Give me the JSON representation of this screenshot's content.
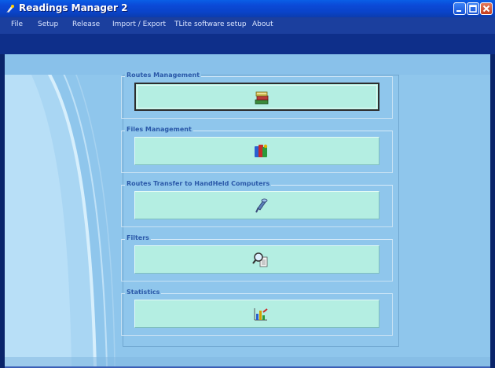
{
  "window": {
    "title": "Readings Manager 2"
  },
  "menu": {
    "items": [
      "File",
      "Setup",
      "Release",
      "Import / Export",
      "TLite software setup",
      "About"
    ]
  },
  "groups": [
    {
      "label": "Routes Management",
      "icon": "books-icon"
    },
    {
      "label": "Files Management",
      "icon": "files-icon"
    },
    {
      "label": "Routes Transfer to HandHeld Computers",
      "icon": "transfer-icon"
    },
    {
      "label": "Filters",
      "icon": "filter-icon"
    },
    {
      "label": "Statistics",
      "icon": "statistics-icon"
    }
  ],
  "colors": {
    "titlebar": "#0a4ad8",
    "content": "#8fc6ec",
    "tile": "#b4eee2",
    "label": "#2a58a8"
  }
}
